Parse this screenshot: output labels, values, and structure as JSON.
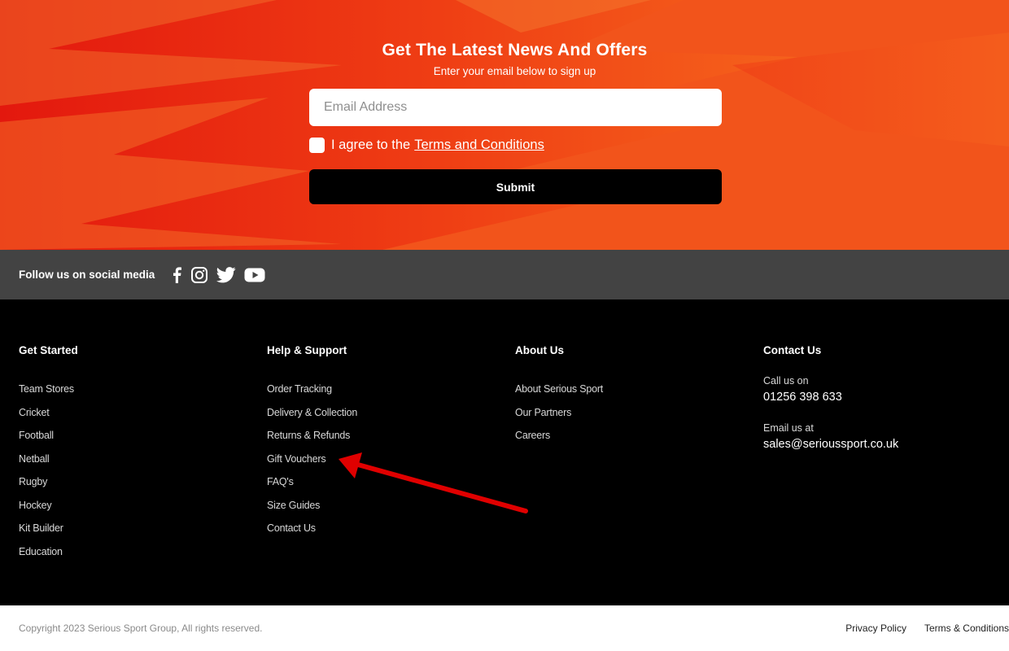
{
  "newsletter": {
    "title": "Get The Latest News And Offers",
    "subtitle": "Enter your email below to sign up",
    "email_placeholder": "Email Address",
    "agree_prefix": "I agree to the",
    "agree_link": "Terms and Conditions",
    "submit_label": "Submit"
  },
  "social": {
    "label": "Follow us on social media",
    "icons": [
      "facebook-icon",
      "instagram-icon",
      "twitter-icon",
      "youtube-icon"
    ]
  },
  "footer": {
    "get_started": {
      "heading": "Get Started",
      "items": [
        "Team Stores",
        "Cricket",
        "Football",
        "Netball",
        "Rugby",
        "Hockey",
        "Kit Builder",
        "Education"
      ]
    },
    "help_support": {
      "heading": "Help & Support",
      "items": [
        "Order Tracking",
        "Delivery & Collection",
        "Returns & Refunds",
        "Gift Vouchers",
        "FAQ's",
        "Size Guides",
        "Contact Us"
      ]
    },
    "about_us": {
      "heading": "About Us",
      "items": [
        "About Serious Sport",
        "Our Partners",
        "Careers"
      ]
    },
    "contact_us": {
      "heading": "Contact Us",
      "call_label": "Call us on",
      "phone": "01256 398 633",
      "email_label": "Email us at",
      "email": "sales@serioussport.co.uk"
    }
  },
  "bottom": {
    "copyright": "Copyright 2023 Serious Sport Group, All rights reserved.",
    "links": [
      "Privacy Policy",
      "Terms & Conditions"
    ]
  },
  "colors": {
    "hero_orange": "#f2541b",
    "hero_red": "#e3180e",
    "social_bar": "#434343",
    "footer_bg": "#000000",
    "annotation_arrow": "#e00000"
  }
}
